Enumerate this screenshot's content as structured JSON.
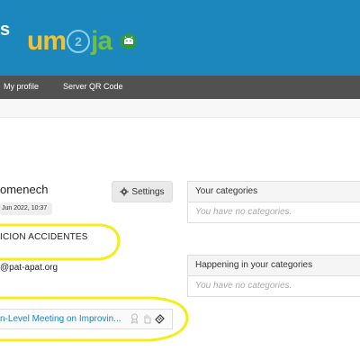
{
  "header": {
    "left_glyph": "s",
    "logo_left": "um",
    "logo_mid": "2",
    "logo_right": "ja",
    "badge_icon": "android-badge-icon",
    "color": "#1b87bd"
  },
  "nav": {
    "items": [
      {
        "label": "My profile"
      },
      {
        "label": "Server QR Code"
      }
    ],
    "color": "#515151"
  },
  "profile": {
    "name": "omenech",
    "date": "Jun 2022, 10:37",
    "settings_label": "Settings",
    "org": "ICION ACCIDENTES",
    "email": "@pat-apat.org"
  },
  "event": {
    "title": "n-Level Meeting on Improvin...",
    "icons": [
      "award-icon",
      "hand-icon",
      "ticket-icon"
    ]
  },
  "panels": [
    {
      "title": "Your categories",
      "empty": "You have no categories."
    },
    {
      "title": "Happening in your categories",
      "empty": "You have no categories."
    }
  ],
  "annotation_color": "#f5ec1a"
}
